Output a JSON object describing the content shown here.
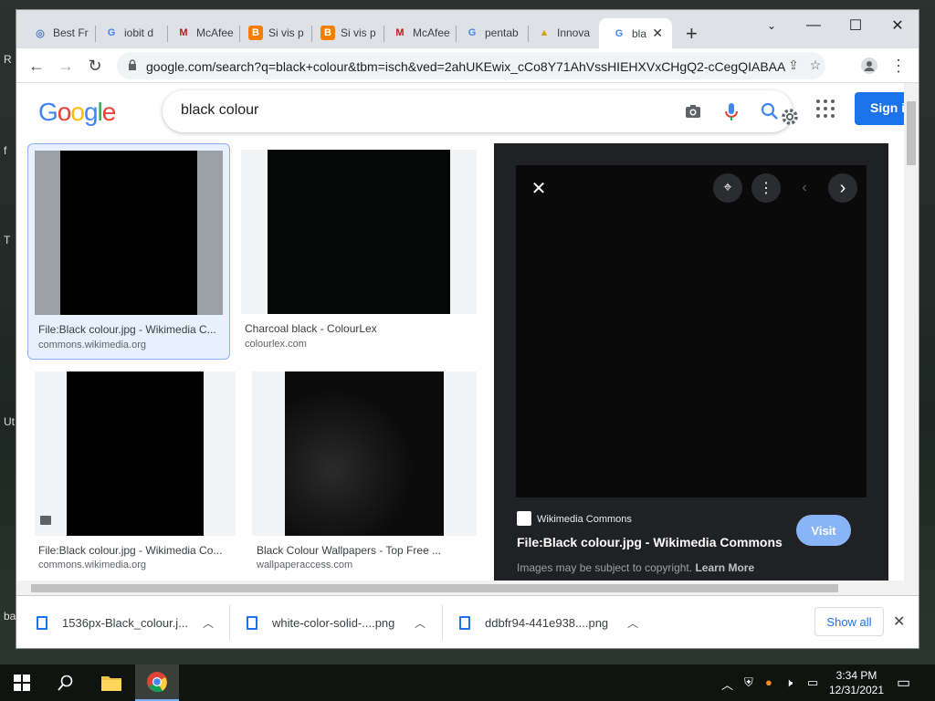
{
  "browser": {
    "tabs": [
      {
        "title": "Best Fr",
        "favicon": "globe-icon"
      },
      {
        "title": "iobit d",
        "favicon": "google-icon"
      },
      {
        "title": "McAfee",
        "favicon": "mcafee-icon"
      },
      {
        "title": "Si vis p",
        "favicon": "blogger-icon"
      },
      {
        "title": "Si vis p",
        "favicon": "blogger-icon"
      },
      {
        "title": "McAfee",
        "favicon": "mcafee-icon"
      },
      {
        "title": "pentab",
        "favicon": "google-icon"
      },
      {
        "title": "Innova",
        "favicon": "innova-icon"
      },
      {
        "title": "bla",
        "favicon": "google-icon",
        "active": true
      }
    ],
    "url": "google.com/search?q=black+colour&tbm=isch&ved=2ahUKEwix_cCo8Y71AhVssHIEHXVxCHgQ2-cCegQIABAA..."
  },
  "google": {
    "logo": "Google",
    "search_query": "black colour",
    "signin_label": "Sign i"
  },
  "results": [
    {
      "title": "File:Black colour.jpg - Wikimedia C...",
      "source": "commons.wikimedia.org"
    },
    {
      "title": "Charcoal black - ColourLex",
      "source": "colourlex.com"
    },
    {
      "title": "File:Black colour.jpg - Wikimedia Co...",
      "source": "commons.wikimedia.org"
    },
    {
      "title": "Black Colour Wallpapers - Top Free ...",
      "source": "wallpaperaccess.com"
    }
  ],
  "preview": {
    "site": "Wikimedia Commons",
    "title": "File:Black colour.jpg - Wikimedia Commons",
    "visit_label": "Visit",
    "copyright_text": "Images may be subject to copyright.",
    "learn_more": "Learn More"
  },
  "downloads": [
    {
      "name": "1536px-Black_colour.j..."
    },
    {
      "name": "white-color-solid-....png"
    },
    {
      "name": "ddbfr94-441e938....png"
    }
  ],
  "downloads_show_all": "Show all",
  "taskbar": {
    "time": "3:34 PM",
    "date": "12/31/2021"
  },
  "desktop_labels": [
    "R",
    "f",
    "T",
    "Ut",
    "ba"
  ],
  "colors": {
    "google_blue": "#1a73e8",
    "preview_bg": "#202124",
    "visit_button": "#8ab4f8"
  }
}
